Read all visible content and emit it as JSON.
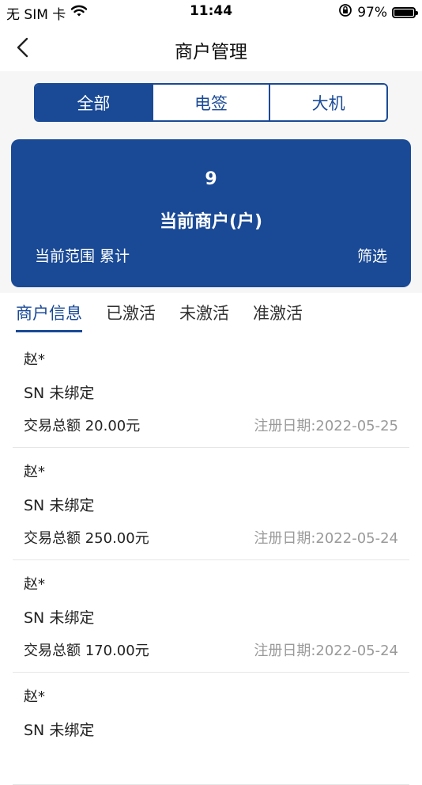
{
  "status_bar": {
    "carrier": "无 SIM 卡",
    "time": "11:44",
    "battery_pct": "97%"
  },
  "nav": {
    "title": "商户管理"
  },
  "segments": [
    {
      "label": "全部",
      "active": true
    },
    {
      "label": "电签",
      "active": false
    },
    {
      "label": "大机",
      "active": false
    }
  ],
  "summary": {
    "count": "9",
    "label": "当前商户(户)",
    "range": "当前范围 累计",
    "filter": "筛选"
  },
  "tabs": [
    {
      "label": "商户信息",
      "active": true
    },
    {
      "label": "已激活",
      "active": false
    },
    {
      "label": "未激活",
      "active": false
    },
    {
      "label": "准激活",
      "active": false
    }
  ],
  "merchants": [
    {
      "name": "赵*",
      "sn": "SN 未绑定",
      "amount": "交易总额 20.00元",
      "date": "注册日期:2022-05-25"
    },
    {
      "name": "赵*",
      "sn": "SN 未绑定",
      "amount": "交易总额 250.00元",
      "date": "注册日期:2022-05-24"
    },
    {
      "name": "赵*",
      "sn": "SN 未绑定",
      "amount": "交易总额 170.00元",
      "date": "注册日期:2022-05-24"
    },
    {
      "name": "赵*",
      "sn": "SN 未绑定",
      "amount": "",
      "date": ""
    }
  ],
  "colors": {
    "primary": "#1a4a96",
    "muted_text": "#9a9a9a"
  }
}
